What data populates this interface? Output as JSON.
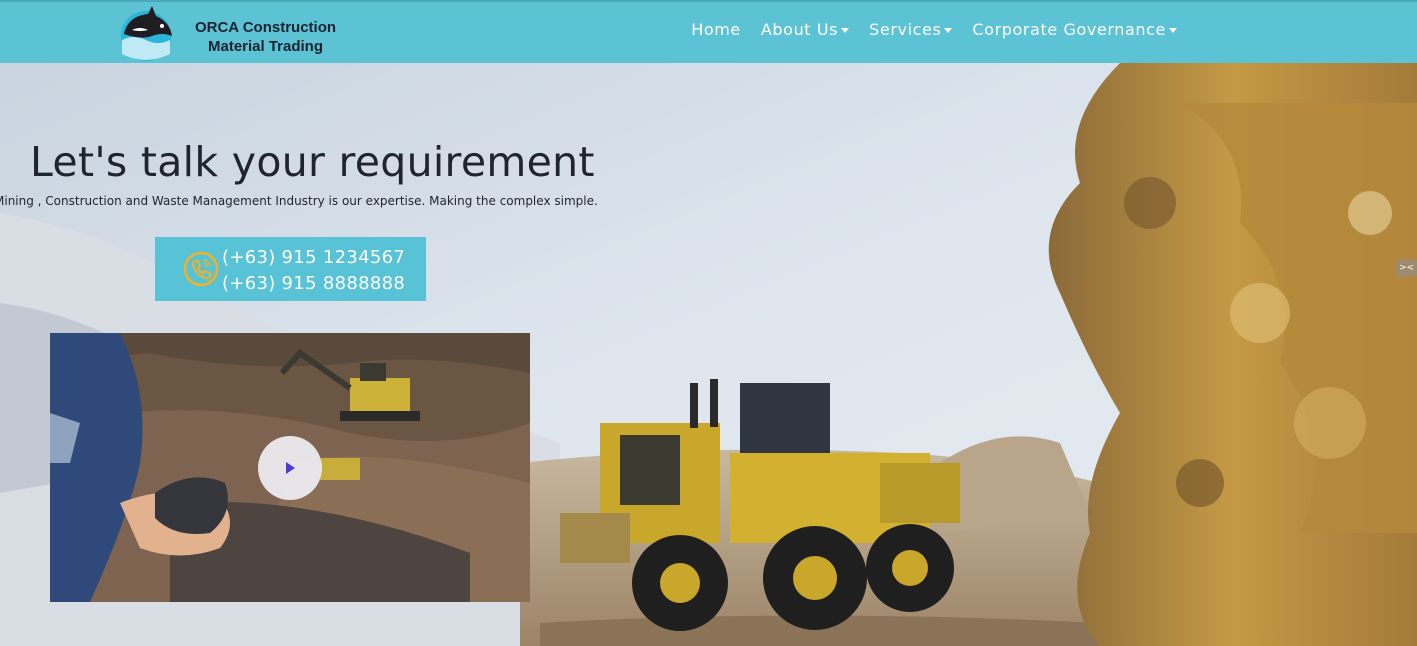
{
  "header": {
    "logo": {
      "icon": "orca-whale-icon",
      "line1": "ORCA Construction",
      "line2": "Material Trading"
    },
    "nav": [
      {
        "label": "Home",
        "has_dropdown": false
      },
      {
        "label": "About Us",
        "has_dropdown": true
      },
      {
        "label": "Services",
        "has_dropdown": true
      },
      {
        "label": "Corporate Governance",
        "has_dropdown": true
      }
    ]
  },
  "hero": {
    "headline": "Let's talk your requirement",
    "subline": "Mining , Construction and Waste Management Industry is our expertise. Making the complex simple.",
    "contact": {
      "icon": "phone-icon",
      "phones": [
        "(+63) 915 1234567",
        "(+63) 915 8888888"
      ]
    },
    "video": {
      "icon": "play-icon"
    },
    "side_control": {
      "icon": "collapse-arrows-icon"
    }
  },
  "colors": {
    "header_bg": "#5bc3d4",
    "contact_bg": "#58c2d6",
    "phone_icon": "#f2b224",
    "play_triangle": "#4c3ccf",
    "text_dark": "#1f2430"
  }
}
